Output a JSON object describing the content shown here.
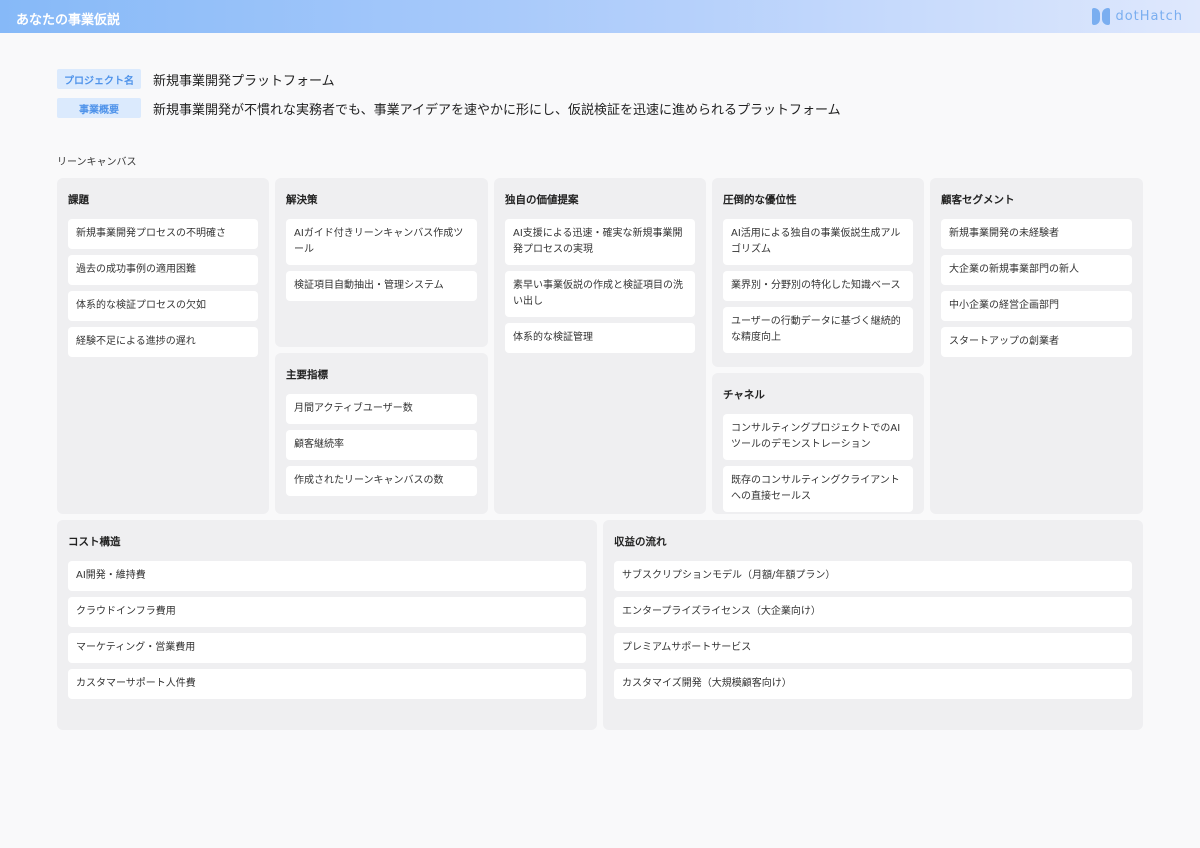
{
  "header": {
    "title": "あなたの事業仮説",
    "logo_text": "dotHatch"
  },
  "project": {
    "name_label": "プロジェクト名",
    "name": "新規事業開発プラットフォーム",
    "summary_label": "事業概要",
    "summary": "新規事業開発が不慣れな実務者でも、事業アイデアを速やかに形にし、仮説検証を迅速に進められるプラットフォーム"
  },
  "canvas_label": "リーンキャンバス",
  "sections": {
    "problem": {
      "title": "課題",
      "items": [
        "新規事業開発プロセスの不明確さ",
        "過去の成功事例の適用困難",
        "体系的な検証プロセスの欠如",
        "経験不足による進捗の遅れ"
      ]
    },
    "solution": {
      "title": "解決策",
      "items": [
        "AIガイド付きリーンキャンバス作成ツール",
        "検証項目自動抽出・管理システム"
      ]
    },
    "metrics": {
      "title": "主要指標",
      "items": [
        "月間アクティブユーザー数",
        "顧客継続率",
        "作成されたリーンキャンバスの数"
      ]
    },
    "uvp": {
      "title": "独自の価値提案",
      "items": [
        "AI支援による迅速・確実な新規事業開発プロセスの実現",
        "素早い事業仮説の作成と検証項目の洗い出し",
        "体系的な検証管理"
      ]
    },
    "advantage": {
      "title": "圧倒的な優位性",
      "items": [
        "AI活用による独自の事業仮説生成アルゴリズム",
        "業界別・分野別の特化した知識ベース",
        "ユーザーの行動データに基づく継続的な精度向上"
      ]
    },
    "channels": {
      "title": "チャネル",
      "items": [
        "コンサルティングプロジェクトでのAIツールのデモンストレーション",
        "既存のコンサルティングクライアントへの直接セールス"
      ]
    },
    "segments": {
      "title": "顧客セグメント",
      "items": [
        "新規事業開発の未経験者",
        "大企業の新規事業部門の新人",
        "中小企業の経営企画部門",
        "スタートアップの創業者"
      ]
    },
    "cost": {
      "title": "コスト構造",
      "items": [
        "AI開発・維持費",
        "クラウドインフラ費用",
        "マーケティング・営業費用",
        "カスタマーサポート人件費"
      ]
    },
    "revenue": {
      "title": "収益の流れ",
      "items": [
        "サブスクリプションモデル（月額/年額プラン）",
        "エンタープライズライセンス（大企業向け）",
        "プレミアムサポートサービス",
        "カスタマイズ開発（大規模顧客向け）"
      ]
    }
  }
}
